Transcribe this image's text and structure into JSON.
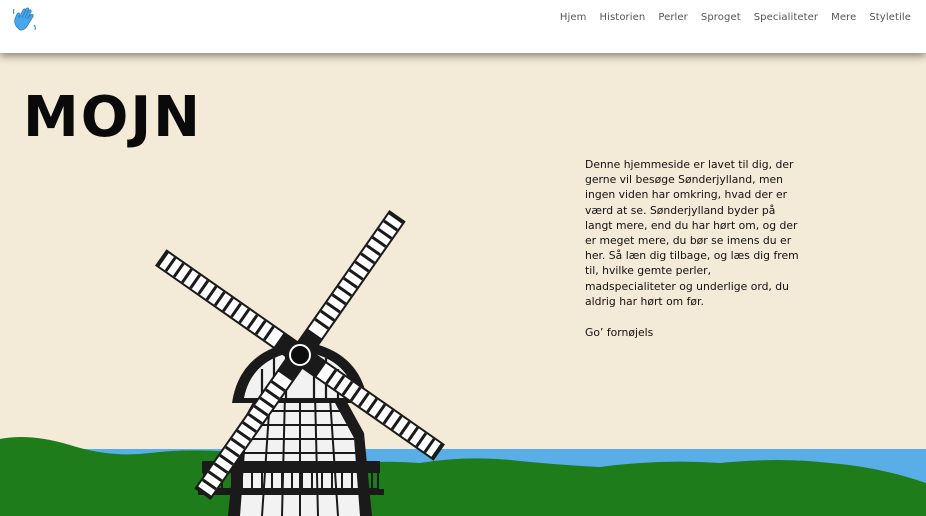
{
  "header": {
    "logo_icon": "waving-hand-icon",
    "nav": [
      {
        "label": "Hjem"
      },
      {
        "label": "Historien"
      },
      {
        "label": "Perler"
      },
      {
        "label": "Sproget"
      },
      {
        "label": "Specialiteter"
      },
      {
        "label": "Mere"
      },
      {
        "label": "Styletile"
      }
    ]
  },
  "hero": {
    "title": "MOJN",
    "intro": "Denne hjemmeside er lavet til dig, der gerne vil besøge Sønderjylland, men ingen viden har omkring, hvad der er værd at se. Sønderjylland byder på langt mere, end du har hørt om, og der er meget mere, du bør se imens du er her. Så læn dig tilbage, og læs dig frem til, hvilke gemte perler, madspecialiteter og underlige ord, du aldrig har hørt om før.",
    "signoff": "Go’ fornøjels",
    "illustration": "windmill-icon"
  },
  "colors": {
    "background": "#f4ead8",
    "sea": "#5aaee8",
    "grass": "#1e7d1a",
    "header": "#ffffff"
  }
}
